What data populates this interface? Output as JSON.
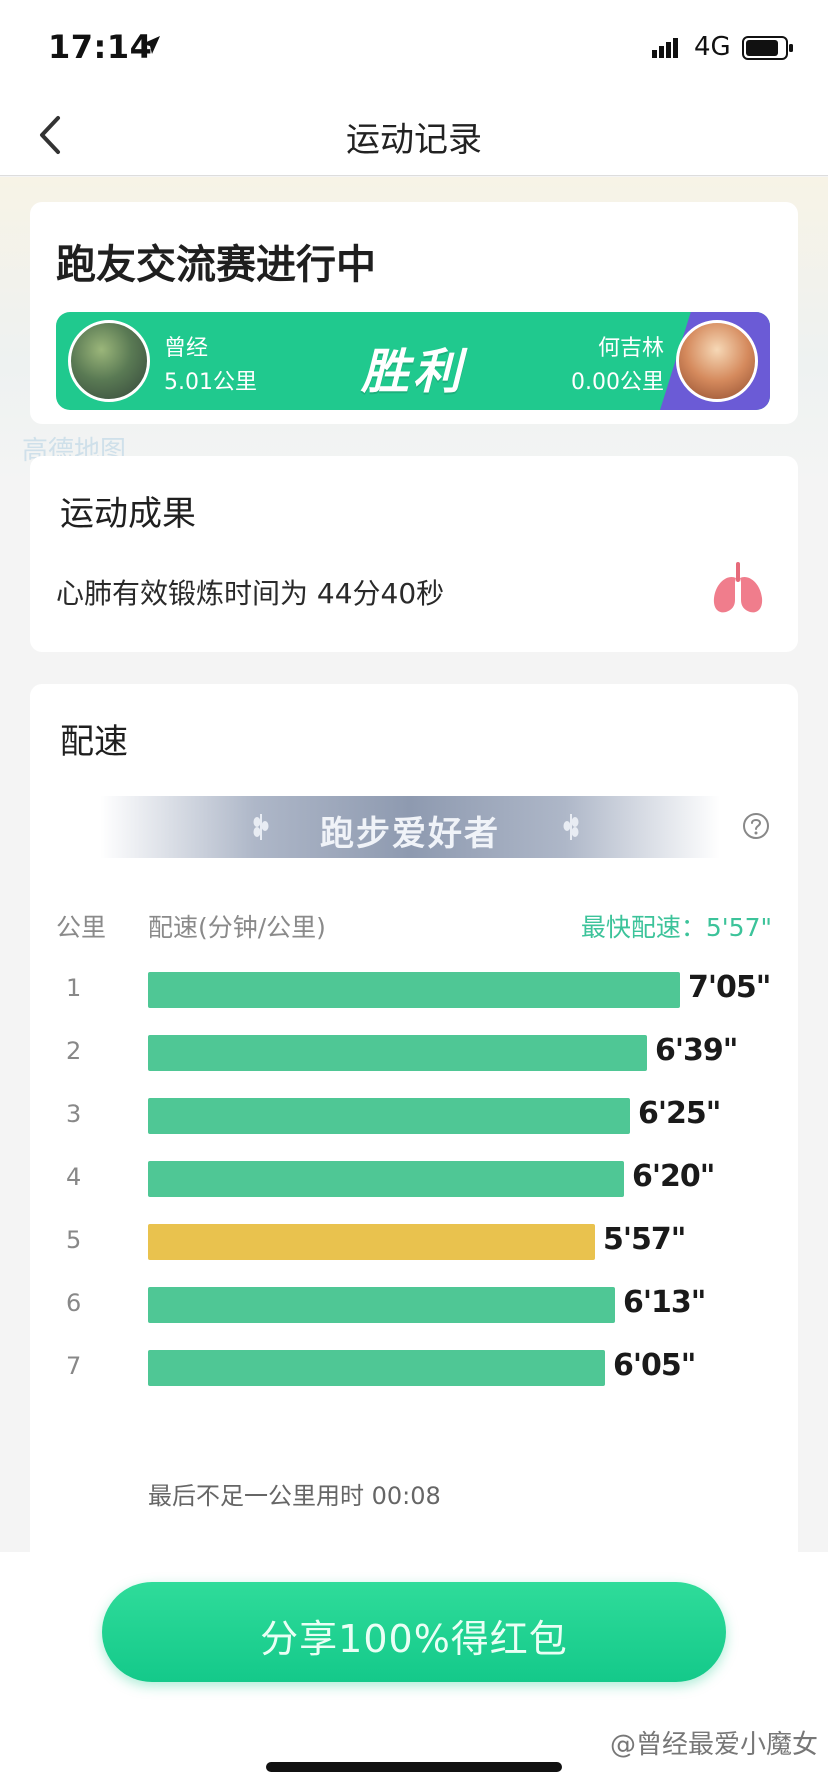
{
  "status_bar": {
    "time": "17:14",
    "network": "4G"
  },
  "nav": {
    "title": "运动记录"
  },
  "map_watermark": "高德地图",
  "match": {
    "title": "跑友交流赛进行中",
    "result": "胜利",
    "left_player": {
      "name": "曾经",
      "distance": "5.01公里"
    },
    "right_player": {
      "name": "何吉林",
      "distance": "0.00公里"
    },
    "colors": {
      "left": "#20c98e",
      "right": "#6b5bd6"
    }
  },
  "achievement": {
    "title": "运动成果",
    "text": "心肺有效锻炼时间为 44分40秒",
    "icon": "lungs-icon"
  },
  "pace": {
    "title": "配速",
    "badge": "跑步爱好者",
    "col_km": "公里",
    "col_pace": "配速(分钟/公里)",
    "fastest": "最快配速：5'57\"",
    "last_note": "最后不足一公里用时 00:08",
    "colors": {
      "normal": "#4fc795",
      "fastest": "#e9c24e"
    }
  },
  "chart_data": {
    "type": "bar",
    "categories": [
      "1",
      "2",
      "3",
      "4",
      "5",
      "6",
      "7"
    ],
    "values": [
      425,
      399,
      385,
      380,
      357,
      373,
      365
    ],
    "labels": [
      "7'05\"",
      "6'39\"",
      "6'25\"",
      "6'20\"",
      "5'57\"",
      "6'13\"",
      "6'05\""
    ],
    "highlight_index": 4,
    "unit": "seconds per km"
  },
  "share": {
    "label": "分享100%得红包"
  },
  "watermark": "@曾经最爱小魔女"
}
